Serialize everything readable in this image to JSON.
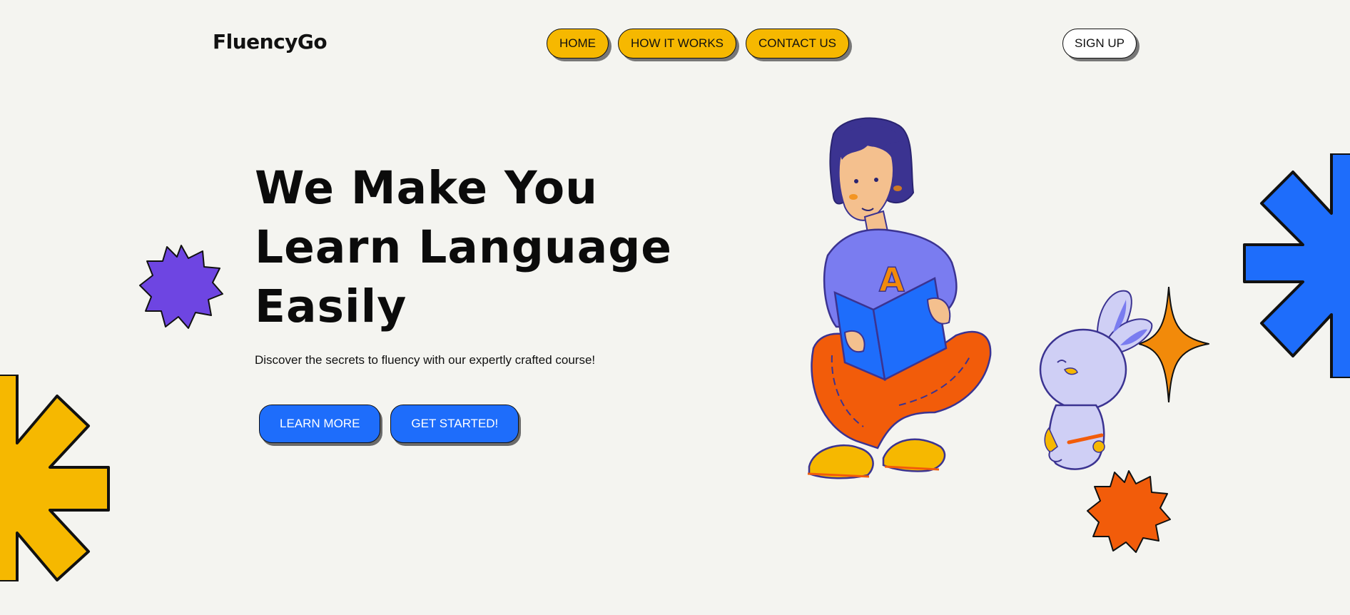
{
  "brand": {
    "name": "FluencyGo"
  },
  "nav": {
    "items": [
      {
        "label": "HOME"
      },
      {
        "label": "HOW IT WORKS"
      },
      {
        "label": "CONTACT US"
      }
    ],
    "signup_label": "SIGN UP"
  },
  "hero": {
    "title_lines": [
      "We Make You",
      "Learn Language",
      "Easily"
    ],
    "subtitle": "Discover the secrets to fluency with our expertly crafted course!",
    "primary_label": "LEARN MORE",
    "secondary_label": "GET STARTED!"
  },
  "illustration": {
    "book_letter": "A"
  },
  "colors": {
    "background": "#f4f4f0",
    "accent_yellow": "#f6b800",
    "accent_blue": "#1e6dfb",
    "accent_purple": "#6e45e2",
    "accent_orange": "#f25c0a",
    "hair": "#3b3391",
    "shirt": "#7a7cf0",
    "pants": "#f25c0a"
  },
  "icons": [
    "purple-badge-icon",
    "yellow-asterisk-icon",
    "blue-asterisk-icon",
    "orange-sparkle-icon",
    "orange-badge-icon"
  ]
}
